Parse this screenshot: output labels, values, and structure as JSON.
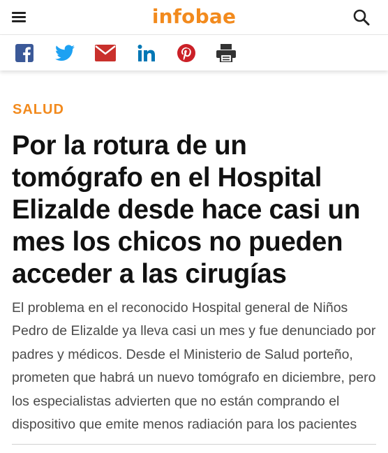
{
  "header": {
    "logo": "infobae",
    "logo_color": "#f28a1d",
    "menu_icon": "hamburger-icon",
    "search_icon": "search-icon"
  },
  "share": [
    {
      "name": "facebook-icon",
      "color": "#3b5998"
    },
    {
      "name": "twitter-icon",
      "color": "#1da1f2"
    },
    {
      "name": "email-icon",
      "color": "#c9302c"
    },
    {
      "name": "linkedin-icon",
      "color": "#0077b5"
    },
    {
      "name": "pinterest-icon",
      "color": "#cb2027"
    },
    {
      "name": "print-icon",
      "color": "#333333"
    }
  ],
  "article": {
    "section": "SALUD",
    "title": "Por la rotura de un tomógrafo en el Hospital Elizalde desde hace casi un mes los chicos no pueden acceder a las cirugías",
    "summary": "El problema en el reconocido Hospital general de Niños Pedro de Elizalde ya lleva casi un mes y fue denunciado por padres y médicos. Desde el Ministerio de Salud porteño, prometen que habrá un nuevo tomógrafo en diciembre, pero los especialistas advierten que no están comprando el dispositivo que emite menos radiación para los pacientes"
  }
}
